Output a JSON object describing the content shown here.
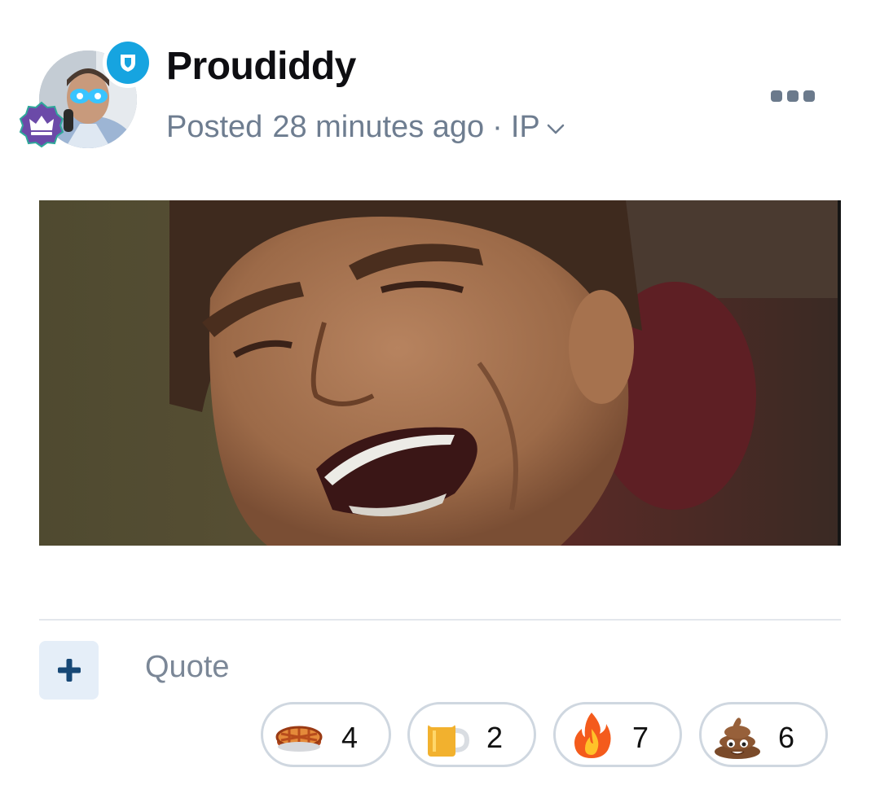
{
  "post": {
    "author": "Proudiddy",
    "meta": {
      "prefix": "Posted",
      "time": "28 minutes ago",
      "separator": "·",
      "ip_label": "IP"
    },
    "icons": {
      "mod_badge": "shield-icon",
      "rank_badge": "crown-icon",
      "more": "more-options-icon",
      "add": "plus-icon"
    }
  },
  "actions": {
    "quote_label": "Quote"
  },
  "reactions": [
    {
      "emoji": "pie",
      "count": "4"
    },
    {
      "emoji": "beer",
      "count": "2"
    },
    {
      "emoji": "fire",
      "count": "7"
    },
    {
      "emoji": "poop",
      "count": "6"
    }
  ],
  "colors": {
    "mod_badge": "#16a4e0",
    "rank_badge": "#6b4aa8",
    "meta_text": "#6e7d90",
    "pill_border": "#cfd7e0"
  }
}
